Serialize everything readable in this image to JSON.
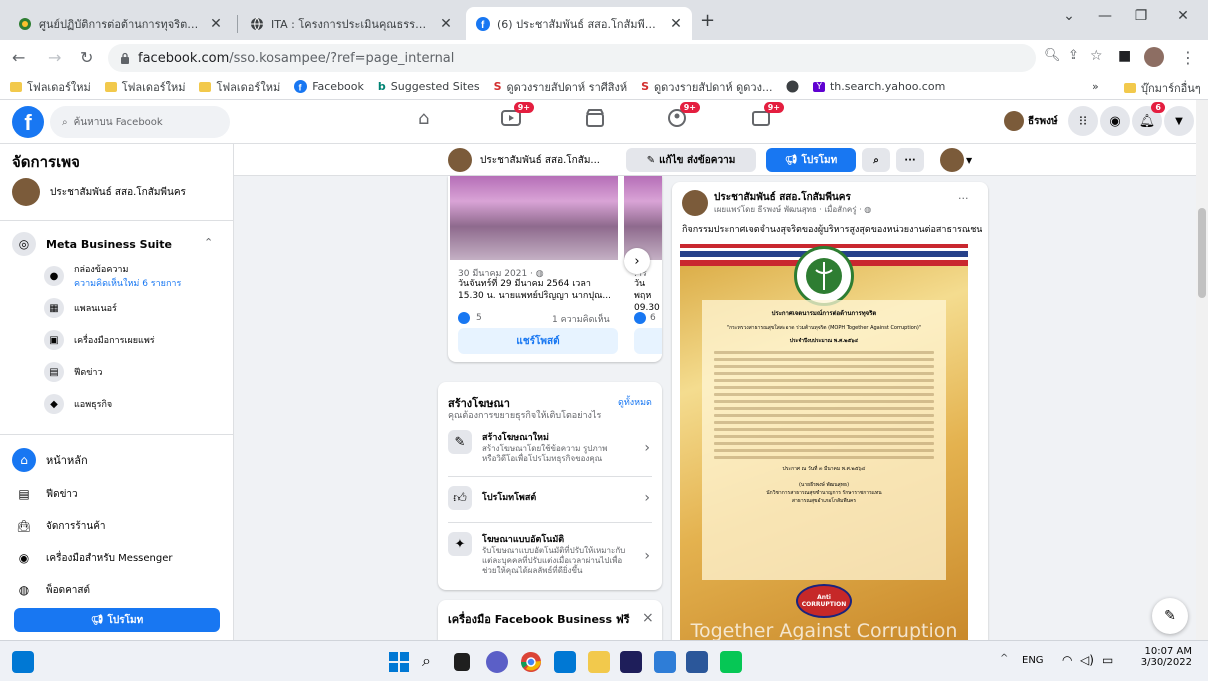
{
  "browser": {
    "tabs": [
      {
        "title": "ศูนย์ปฏิบัติการต่อต้านการทุจริต กระทรวง",
        "active": false
      },
      {
        "title": "ITA : โครงการประเมินคุณธรรมและความ",
        "active": false
      },
      {
        "title": "(6) ประชาสัมพันธ์ สสอ.โกสัมพีนคร | F",
        "active": true
      }
    ],
    "new_tab": "+",
    "url_host": "facebook.com",
    "url_path": "/sso.kosampee/?ref=page_internal",
    "bookmarks": [
      {
        "label": "โฟลเดอร์ใหม่",
        "icon": "folder-icon"
      },
      {
        "label": "โฟลเดอร์ใหม่",
        "icon": "folder-icon"
      },
      {
        "label": "โฟลเดอร์ใหม่",
        "icon": "folder-icon"
      },
      {
        "label": "Facebook",
        "icon": "facebook-icon"
      },
      {
        "label": "Suggested Sites",
        "icon": "bing-icon"
      },
      {
        "label": "ดูดวงรายสัปดาห์ ราศีสิงห์",
        "icon": "horoscope-icon"
      },
      {
        "label": "ดูดวงรายสัปดาห์ ดูดวง...",
        "icon": "horoscope-icon"
      },
      {
        "label": "th.search.yahoo.com",
        "icon": "yahoo-icon"
      }
    ],
    "bookmarks_more": "»",
    "other_bookmarks": "บุ๊กมาร์กอื่นๆ"
  },
  "fb_header": {
    "search_placeholder": "ค้นหาบน Facebook",
    "badges": {
      "watch": "9+",
      "groups": "9+",
      "gaming": "9+",
      "notifications": "6"
    },
    "profile_name": "ธีรพงษ์"
  },
  "sidebar": {
    "title": "จัดการเพจ",
    "page_name": "ประชาสัมพันธ์ สสอ.โกสัมพีนคร",
    "business_suite": "Meta Business Suite",
    "inbox": {
      "label": "กล่องข้อความ",
      "sub": "ความคิดเห็นใหม่ 6 รายการ"
    },
    "planner": "แพลนเนอร์",
    "publishing_tools": "เครื่องมือการเผยแพร่",
    "news_feed": "ฟีดข่าว",
    "business_apps": "แอพธุรกิจ",
    "home": "หน้าหลัก",
    "feed": "ฟีดข่าว",
    "shop": "จัดการร้านค้า",
    "messenger_tools": "เครื่องมือสำหรับ Messenger",
    "podcasts": "พ็อดคาสต์",
    "promote_button": "โปรโมท"
  },
  "topbar": {
    "page_name": "ประชาสัมพันธ์ สสอ.โกสัม...",
    "edit_button": "แก้ไข ส่งข้อความ",
    "promote_button": "โปรโมท",
    "more": "···"
  },
  "photo_card": {
    "date": "30 มีนาคม 2021 · ",
    "text1": "วันจันทร์ที่ 29 มีนาคม 2564 เวลา",
    "text2": "15.30 น. นายแพทย์ปริญญา นากปุณ...",
    "likes": "5",
    "comments": "1 ความคิดเห็น",
    "share_button": "แชร์โพสต์",
    "peek_text1": "วันพฤห",
    "peek_text2": "09.30 น",
    "peek_likes": "6",
    "peek_date": ".าร"
  },
  "ads_card": {
    "title": "สร้างโฆษณา",
    "see_all": "ดูทั้งหมด",
    "subtitle": "คุณต้องการขยายธุรกิจให้เติบโตอย่างไร",
    "items": [
      {
        "title": "สร้างโฆษณาใหม่",
        "desc": "สร้างโฆษณาโดยใช้ข้อความ รูปภาพ หรือวิดีโอเพื่อโปรโมทธุรกิจของคุณ"
      },
      {
        "title": "โปรโมทโพสต์",
        "desc": ""
      },
      {
        "title": "โฆษณาแบบอัตโนมัติ",
        "desc": "รับโฆษณาแบบอัตโนมัติที่ปรับให้เหมาะกับแต่ละบุคคลที่ปรับแต่งเมื่อเวลาผ่านไปเพื่อช่วยให้คุณได้ผลลัพธ์ที่ดียิ่งขึ้น"
      }
    ]
  },
  "tools_card": {
    "title": "เครื่องมือ Facebook Business ฟรี",
    "close": "×"
  },
  "post": {
    "page_name": "ประชาสัมพันธ์ สสอ.โกสัมพีนคร",
    "meta": "เผยแพร่โดย ธีรพงษ์ พัฒนสุทธ · เมื่อสักครู่ · ",
    "more": "···",
    "caption": "กิจกรรมประกาศเจตจำนงสุจริตของผู้บริหารสูงสุดของหน่วยงานต่อสาธารณชน",
    "cert_heading": "ประกาศเจตนารมณ์การต่อต้านการทุจริต",
    "cert_campaign": "\"กระทรวงสาธารณสุขใสสะอาด ร่วมต้านทุจริต (MOPH Together Against Corruption)\"",
    "cert_year": "ประจำปีงบประมาณ พ.ศ.๒๕๖๔",
    "cert_date": "ประกาศ ณ วันที่ ๓ มีนาคม พ.ศ.๒๕๖๔",
    "cert_signer": "(นายธีรพงษ์ พัฒนสุทธ)",
    "cert_position": "นักวิชาการสาธารณสุขชำนาญการ รักษาราชการแทน",
    "cert_office": "สาธารณสุขอำเภอโกสัมพีนคร",
    "cert_logo": "Anti CORRUPTION",
    "watermark": "Together Against Corruption"
  },
  "taskbar": {
    "language": "ENG",
    "time": "10:07 AM",
    "date": "3/30/2022",
    "up_arrow": "^"
  }
}
